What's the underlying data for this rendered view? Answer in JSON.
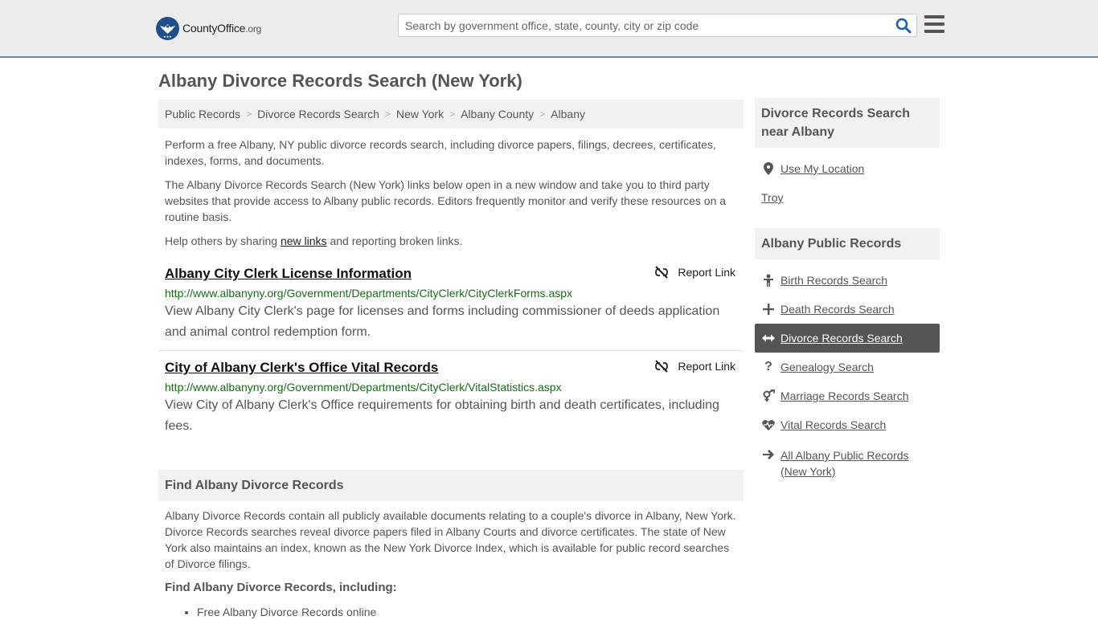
{
  "header": {
    "logo_main": "CountyOffice",
    "logo_suffix": ".org",
    "search_placeholder": "Search by government office, state, county, city or zip code"
  },
  "page_title": "Albany Divorce Records Search (New York)",
  "breadcrumb": [
    "Public Records",
    "Divorce Records Search",
    "New York",
    "Albany County",
    "Albany"
  ],
  "intro": {
    "p1": "Perform a free Albany, NY public divorce records search, including divorce papers, filings, decrees, certificates, indexes, forms, and documents.",
    "p2": "The Albany Divorce Records Search (New York) links below open in a new window and take you to third party websites that provide access to Albany public records. Editors frequently monitor and verify these resources on a routine basis.",
    "p3_before": "Help others by sharing ",
    "p3_link": "new links",
    "p3_after": " and reporting broken links."
  },
  "results": [
    {
      "title": "Albany City Clerk License Information",
      "url": "http://www.albanyny.org/Government/Departments/CityClerk/CityClerkForms.aspx",
      "desc": "View Albany City Clerk's page for licenses and forms including commissioner of deeds application and animal control redemption form.",
      "report": "Report Link"
    },
    {
      "title": "City of Albany Clerk's Office Vital Records",
      "url": "http://www.albanyny.org/Government/Departments/CityClerk/VitalStatistics.aspx",
      "desc": "View City of Albany Clerk's Office requirements for obtaining birth and death certificates, including fees.",
      "report": "Report Link"
    }
  ],
  "find_section": {
    "heading": "Find Albany Divorce Records",
    "body": "Albany Divorce Records contain all publicly available documents relating to a couple's divorce in Albany, New York. Divorce Records searches reveal divorce papers filed in Albany Courts and divorce certificates. The state of New York also maintains an index, known as the New York Divorce Index, which is available for public record searches of Divorce filings.",
    "subheading": "Find Albany Divorce Records, including:",
    "bullets": [
      "Free Albany Divorce Records online"
    ]
  },
  "sidebar": {
    "near_heading": "Divorce Records Search near Albany",
    "use_location": "Use My Location",
    "nearby": [
      "Troy"
    ],
    "public_heading": "Albany Public Records",
    "links": [
      {
        "label": "Birth Records Search",
        "icon": "baby-icon"
      },
      {
        "label": "Death Records Search",
        "icon": "cross-icon"
      },
      {
        "label": "Divorce Records Search",
        "icon": "arrows-icon",
        "active": true
      },
      {
        "label": "Genealogy Search",
        "icon": "question-icon"
      },
      {
        "label": "Marriage Records Search",
        "icon": "gender-icon"
      },
      {
        "label": "Vital Records Search",
        "icon": "heartbeat-icon"
      }
    ],
    "all_link": "All Albany Public Records (New York)"
  },
  "colors": {
    "header_bg": "#ededed",
    "header_border": "#5b8db8",
    "logo_blue": "#1e4f8b",
    "url_green": "#1a6b1a",
    "search_icon": "#1f5fa5",
    "active_bg": "#555555"
  }
}
